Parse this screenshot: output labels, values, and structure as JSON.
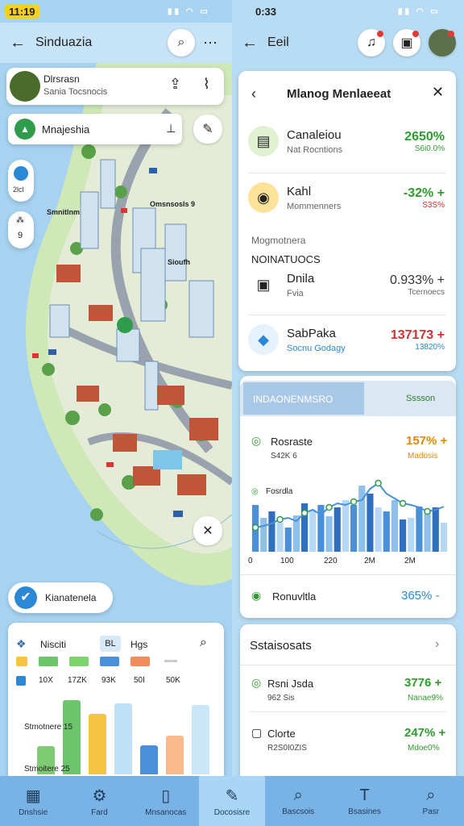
{
  "left": {
    "status_time": "11:19",
    "title": "Sinduazia",
    "profile": {
      "name": "Dlrsrasn",
      "subtitle": "Sania Tocsnocis"
    },
    "search_chip": "Mnajeshia",
    "map_side": {
      "top_label": "2lcl",
      "mid_label": "9"
    },
    "map_labels": [
      "Smnitlnm",
      "Omsnsosls 9",
      "Sioufh"
    ],
    "map_compass": "N",
    "mgmt_chip": "Kianatenela",
    "stats_card": {
      "tabs": [
        "Nisciti",
        "Hgs"
      ],
      "legend_vals": [
        "10X",
        "17ZK",
        "93K",
        "50I",
        "50K"
      ],
      "bar_labels": [
        "Stmotnere 15",
        "Stmoitere 25"
      ],
      "colors": [
        "#6cc56a",
        "#7bd46c",
        "#4a90d9",
        "#f28c5a",
        "#e0e0e0"
      ],
      "bars": [
        {
          "value": 35,
          "color": "#7fcb73"
        },
        {
          "value": 92,
          "color": "#6cc56a"
        },
        {
          "value": 75,
          "color": "#f5c542"
        },
        {
          "value": 88,
          "color": "#bfe0f7"
        },
        {
          "value": 36,
          "color": "#4a90d9"
        },
        {
          "value": 48,
          "color": "#f9b98b"
        },
        {
          "value": 86,
          "color": "#cbe6f9"
        }
      ]
    }
  },
  "right": {
    "status_time": "0:33",
    "title": "Eeil",
    "panel": {
      "title": "Mlanog Menlaeeat",
      "items": [
        {
          "title": "Canaleiou",
          "subtitle": "Nat Rocntions",
          "pct": "2650%",
          "sub": "S6i0.0%",
          "pct_color": "green",
          "icon": "▤",
          "icon_bg": "#e2f3d6"
        },
        {
          "title": "Kahl",
          "subtitle": "Mommenners",
          "pct": "-32% +",
          "sub": "S3S%",
          "pct_color": "green",
          "icon": "◉",
          "icon_bg": "#fde6a0"
        }
      ],
      "section_label": "Mogmotnera",
      "section_heading": "NOINATUOCS",
      "items2": [
        {
          "title": "Dnila",
          "subtitle": "Fvia",
          "pct": "0.933% +",
          "sub": "Tcernoecs",
          "pct_color": "plain",
          "icon": "▣",
          "icon_bg": "#ffffff"
        },
        {
          "title": "SabPaka",
          "subtitle": "Socnu Godagy",
          "pct": "137173 +",
          "sub": "13820%",
          "pct_color": "red",
          "icon": "◆",
          "icon_bg": "#ffffff"
        }
      ]
    },
    "chart_card": {
      "tab_active": "INDAONENMSRO",
      "tab_other": "Sssson",
      "metrics": [
        {
          "title": "Rosraste",
          "sub": "S42K 6",
          "pct": "157% +",
          "sub2": "Madosis",
          "color": "orange"
        },
        {
          "title": "Fosrdla",
          "sub": "",
          "pct": "",
          "sub2": "",
          "color": "plain"
        }
      ],
      "foot_title": "Ronuvltla",
      "foot_pct": "365% -",
      "chart_data": {
        "type": "bar",
        "x_ticks": [
          "0",
          "100",
          "220",
          "2M",
          "2M"
        ],
        "values": [
          58,
          42,
          50,
          36,
          30,
          45,
          60,
          52,
          58,
          44,
          55,
          64,
          58,
          82,
          72,
          55,
          50,
          64,
          40,
          42,
          56,
          50,
          55,
          36
        ],
        "line": [
          30,
          32,
          35,
          40,
          42,
          38,
          48,
          52,
          46,
          55,
          60,
          58,
          62,
          64,
          78,
          85,
          72,
          66,
          60,
          58,
          55,
          50,
          52,
          56
        ]
      }
    },
    "stats_card": {
      "title": "Sstaisosats",
      "items": [
        {
          "title": "Rsni Jsda",
          "sub": "962 Sis",
          "pct": "3776 +",
          "sub2": "Nanae9%",
          "color": "green",
          "icon": "◎"
        },
        {
          "title": "Clorte",
          "sub": "R2S0I0ZIS",
          "pct": "247% +",
          "sub2": "Mdoe0%",
          "color": "green",
          "icon": "▢"
        }
      ]
    }
  },
  "nav": [
    {
      "label": "Dnshsie",
      "icon": "▦",
      "active": false
    },
    {
      "label": "Fard",
      "icon": "⚙",
      "active": false
    },
    {
      "label": "Mnsanocas",
      "icon": "▯",
      "active": false
    },
    {
      "label": "Docosisre",
      "icon": "✎",
      "active": true
    },
    {
      "label": "Bascsois",
      "icon": "⌕",
      "active": false
    },
    {
      "label": "Bsasines",
      "icon": "T",
      "active": false
    },
    {
      "label": "Pasr",
      "icon": "⌕",
      "active": false
    }
  ]
}
